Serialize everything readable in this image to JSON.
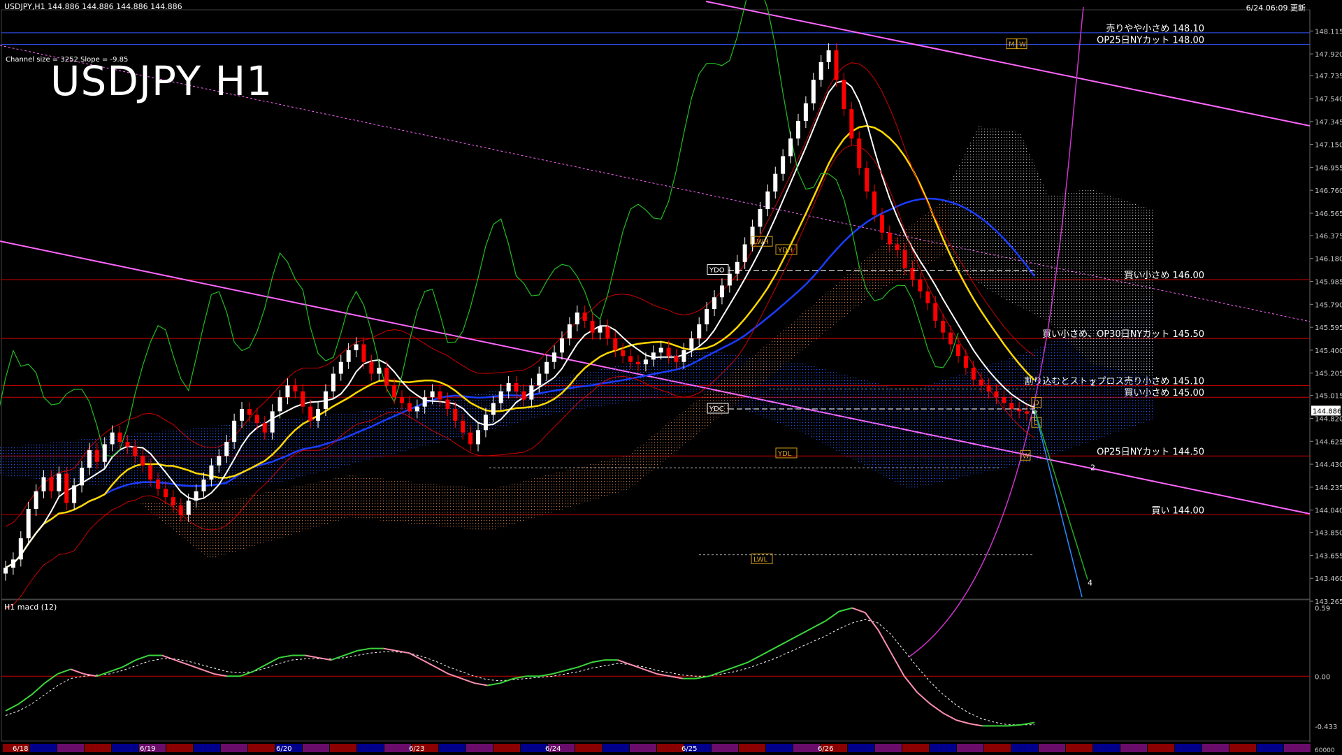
{
  "header": {
    "symbol_info": "USDJPY,H1  144.886 144.886 144.886 144.886",
    "updated": "6/24 06:09 更新",
    "channel_info": "Channel size = 3252 Slope = -9.85",
    "big_title": "USDJPY H1"
  },
  "colors": {
    "background": "#000000",
    "bull_candle": "#ffffff",
    "bear_candle": "#ff0000",
    "ma_fast": "#ffffff",
    "ma_mid": "#ffd700",
    "ma_slow": "#1a3cff",
    "chikou": "#22bb22",
    "level_line": "#cc0000",
    "channel": "#ff66ff",
    "macd_up": "#3ad63a",
    "macd_down": "#ff8fb0",
    "signal": "#ffffff"
  },
  "chart_data": {
    "type": "candlestick",
    "title": "USDJPY H1",
    "ylim": [
      143.265,
      148.2
    ],
    "y_ticks": [
      "148.115",
      "147.920",
      "147.735",
      "147.540",
      "147.345",
      "147.150",
      "146.955",
      "146.760",
      "146.565",
      "146.375",
      "146.180",
      "145.985",
      "145.790",
      "145.595",
      "145.400",
      "145.205",
      "145.015",
      "144.886",
      "144.820",
      "144.625",
      "144.430",
      "144.235",
      "144.040",
      "143.850",
      "143.655",
      "143.460",
      "143.265"
    ],
    "x_ticks": [
      "6/18",
      "6/19",
      "6/20",
      "6/23",
      "6/24",
      "6/25",
      "6/26"
    ],
    "close": [
      143.55,
      143.62,
      143.8,
      144.05,
      144.2,
      144.32,
      144.2,
      144.35,
      144.1,
      144.25,
      144.4,
      144.55,
      144.45,
      144.6,
      144.7,
      144.62,
      144.58,
      144.5,
      144.42,
      144.3,
      144.22,
      144.15,
      144.08,
      144.0,
      144.12,
      144.2,
      144.3,
      144.42,
      144.5,
      144.62,
      144.8,
      144.9,
      144.85,
      144.78,
      144.7,
      144.88,
      145.0,
      145.1,
      145.05,
      144.92,
      144.8,
      144.9,
      145.05,
      145.2,
      145.3,
      145.4,
      145.45,
      145.3,
      145.2,
      145.25,
      145.1,
      145.0,
      144.95,
      144.88,
      144.92,
      145.0,
      145.05,
      144.98,
      144.9,
      144.8,
      144.7,
      144.6,
      144.72,
      144.85,
      144.95,
      145.05,
      145.12,
      145.05,
      144.98,
      145.1,
      145.2,
      145.3,
      145.38,
      145.5,
      145.62,
      145.72,
      145.65,
      145.55,
      145.6,
      145.5,
      145.4,
      145.35,
      145.3,
      145.28,
      145.32,
      145.38,
      145.42,
      145.35,
      145.3,
      145.4,
      145.5,
      145.62,
      145.75,
      145.85,
      145.95,
      146.05,
      146.15,
      146.3,
      146.45,
      146.6,
      146.75,
      146.9,
      147.05,
      147.2,
      147.35,
      147.5,
      147.7,
      147.85,
      147.95,
      147.7,
      147.45,
      147.2,
      146.95,
      146.75,
      146.55,
      146.4,
      146.3,
      146.25,
      146.1,
      146.0,
      145.9,
      145.8,
      145.65,
      145.55,
      145.45,
      145.35,
      145.25,
      145.15,
      145.1,
      145.05,
      145.0,
      144.95,
      144.9,
      144.88,
      144.86,
      144.886
    ],
    "levels": [
      {
        "label": "売りやや小さめ 148.10",
        "price": 148.1
      },
      {
        "label": "OP25日NYカット 148.00",
        "price": 148.0
      },
      {
        "label": "買い小さめ 146.00",
        "price": 146.0
      },
      {
        "label": "買い小さめ、OP30日NYカット 145.50",
        "price": 145.5
      },
      {
        "label": "割り込むとストップロス売り小さめ 145.10",
        "price": 145.1
      },
      {
        "label": "買い小さめ 145.00",
        "price": 145.0
      },
      {
        "label": "OP25日NYカット 144.50",
        "price": 144.5
      },
      {
        "label": "買い 144.00",
        "price": 144.0
      }
    ],
    "markers": [
      "YDO",
      "YDC",
      "YDH",
      "YDL",
      "LWH",
      "LWL",
      "M",
      "W",
      "D",
      "D",
      "W"
    ],
    "wave_labels": [
      "1",
      "2",
      "4"
    ],
    "current_price": "144.886"
  },
  "macd": {
    "label": "H1  macd (12)",
    "ticks": [
      "0.59",
      "0.00",
      "-0.433"
    ],
    "ylim": [
      -0.5,
      0.6
    ],
    "values": [
      -0.3,
      -0.24,
      -0.16,
      -0.06,
      0.02,
      0.06,
      0.02,
      0.0,
      0.04,
      0.08,
      0.14,
      0.18,
      0.18,
      0.14,
      0.1,
      0.06,
      0.02,
      0.0,
      0.0,
      0.04,
      0.1,
      0.16,
      0.18,
      0.18,
      0.16,
      0.14,
      0.18,
      0.22,
      0.24,
      0.24,
      0.22,
      0.2,
      0.14,
      0.08,
      0.02,
      -0.02,
      -0.06,
      -0.08,
      -0.06,
      -0.02,
      0.0,
      0.0,
      0.02,
      0.05,
      0.08,
      0.12,
      0.14,
      0.14,
      0.1,
      0.06,
      0.02,
      0.0,
      -0.02,
      -0.02,
      0.0,
      0.04,
      0.08,
      0.12,
      0.18,
      0.24,
      0.3,
      0.36,
      0.42,
      0.48,
      0.56,
      0.59,
      0.55,
      0.4,
      0.2,
      0.0,
      -0.14,
      -0.24,
      -0.32,
      -0.38,
      -0.41,
      -0.43,
      -0.43,
      -0.43,
      -0.42,
      -0.4
    ],
    "signal": [
      -0.34,
      -0.3,
      -0.24,
      -0.16,
      -0.08,
      -0.02,
      0.0,
      0.01,
      0.02,
      0.05,
      0.09,
      0.13,
      0.15,
      0.15,
      0.13,
      0.1,
      0.07,
      0.04,
      0.03,
      0.04,
      0.07,
      0.11,
      0.14,
      0.15,
      0.15,
      0.15,
      0.16,
      0.18,
      0.2,
      0.21,
      0.21,
      0.2,
      0.17,
      0.13,
      0.08,
      0.04,
      0.0,
      -0.03,
      -0.04,
      -0.03,
      -0.02,
      -0.01,
      0.0,
      0.02,
      0.04,
      0.07,
      0.09,
      0.11,
      0.1,
      0.08,
      0.05,
      0.03,
      0.01,
      0.0,
      0.0,
      0.02,
      0.04,
      0.07,
      0.11,
      0.15,
      0.2,
      0.25,
      0.3,
      0.35,
      0.41,
      0.46,
      0.49,
      0.46,
      0.36,
      0.22,
      0.08,
      -0.05,
      -0.16,
      -0.25,
      -0.32,
      -0.37,
      -0.4,
      -0.42,
      -0.42,
      -0.42
    ]
  },
  "date_bar": {
    "labels": [
      "6/18",
      "6/19",
      "6/20",
      "6/23",
      "6/24",
      "6/25",
      "6/26"
    ]
  }
}
